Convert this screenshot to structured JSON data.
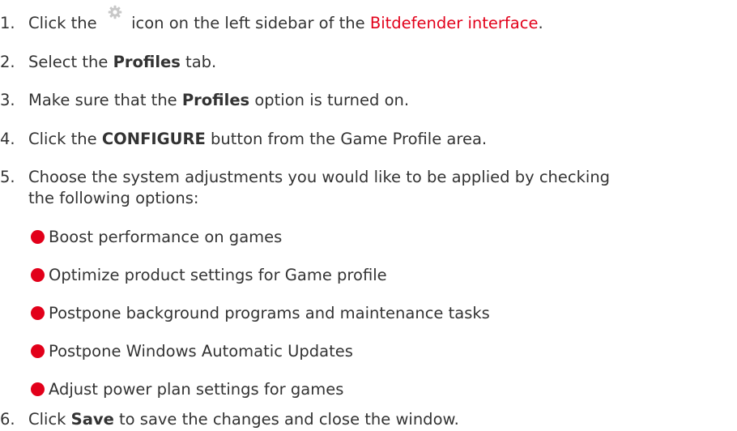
{
  "steps": [
    {
      "number": "1.",
      "before": "Click the ",
      "icon": "gear-icon",
      "middle": " icon on the left sidebar of the ",
      "link": "Bitdefender interface",
      "after": "."
    },
    {
      "number": "2.",
      "before": "Select the ",
      "bold": "Profiles",
      "after": " tab."
    },
    {
      "number": "3.",
      "before": "Make sure that the ",
      "bold": "Profiles",
      "after": " option is turned on."
    },
    {
      "number": "4.",
      "before": "Click the ",
      "bold": "CONFIGURE",
      "after": " button from the Game Profile area."
    },
    {
      "number": "5.",
      "line1": "Choose the system adjustments you would like to be applied by checking",
      "line2": "the following options:"
    },
    {
      "number": "6.",
      "before": "Click ",
      "bold": "Save",
      "after": " to save the changes and close the window."
    }
  ],
  "options": [
    "Boost performance on games",
    "Optimize product settings for Game profile",
    "Postpone background programs and maintenance tasks",
    "Postpone Windows Automatic Updates",
    "Adjust power plan settings for games"
  ],
  "colors": {
    "accent": "#e2001a",
    "text": "#333333",
    "icon": "#c8c8c8"
  }
}
